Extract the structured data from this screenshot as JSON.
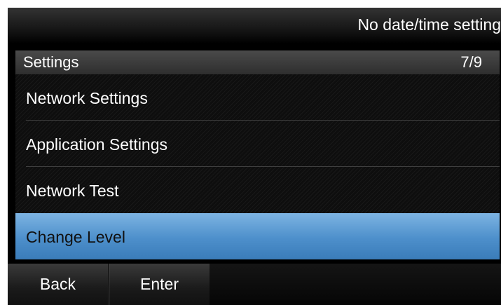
{
  "status_bar": {
    "text": "No date/time setting"
  },
  "title_bar": {
    "title": "Settings",
    "page_indicator": "7/9"
  },
  "menu": {
    "items": [
      {
        "label": "Network Settings",
        "selected": false
      },
      {
        "label": "Application Settings",
        "selected": false
      },
      {
        "label": "Network Test",
        "selected": false
      },
      {
        "label": "Change Level",
        "selected": true
      }
    ]
  },
  "softkeys": {
    "back": "Back",
    "enter": "Enter"
  },
  "colors": {
    "selection": "#5a9bd5",
    "background": "#000000",
    "text": "#ffffff"
  }
}
